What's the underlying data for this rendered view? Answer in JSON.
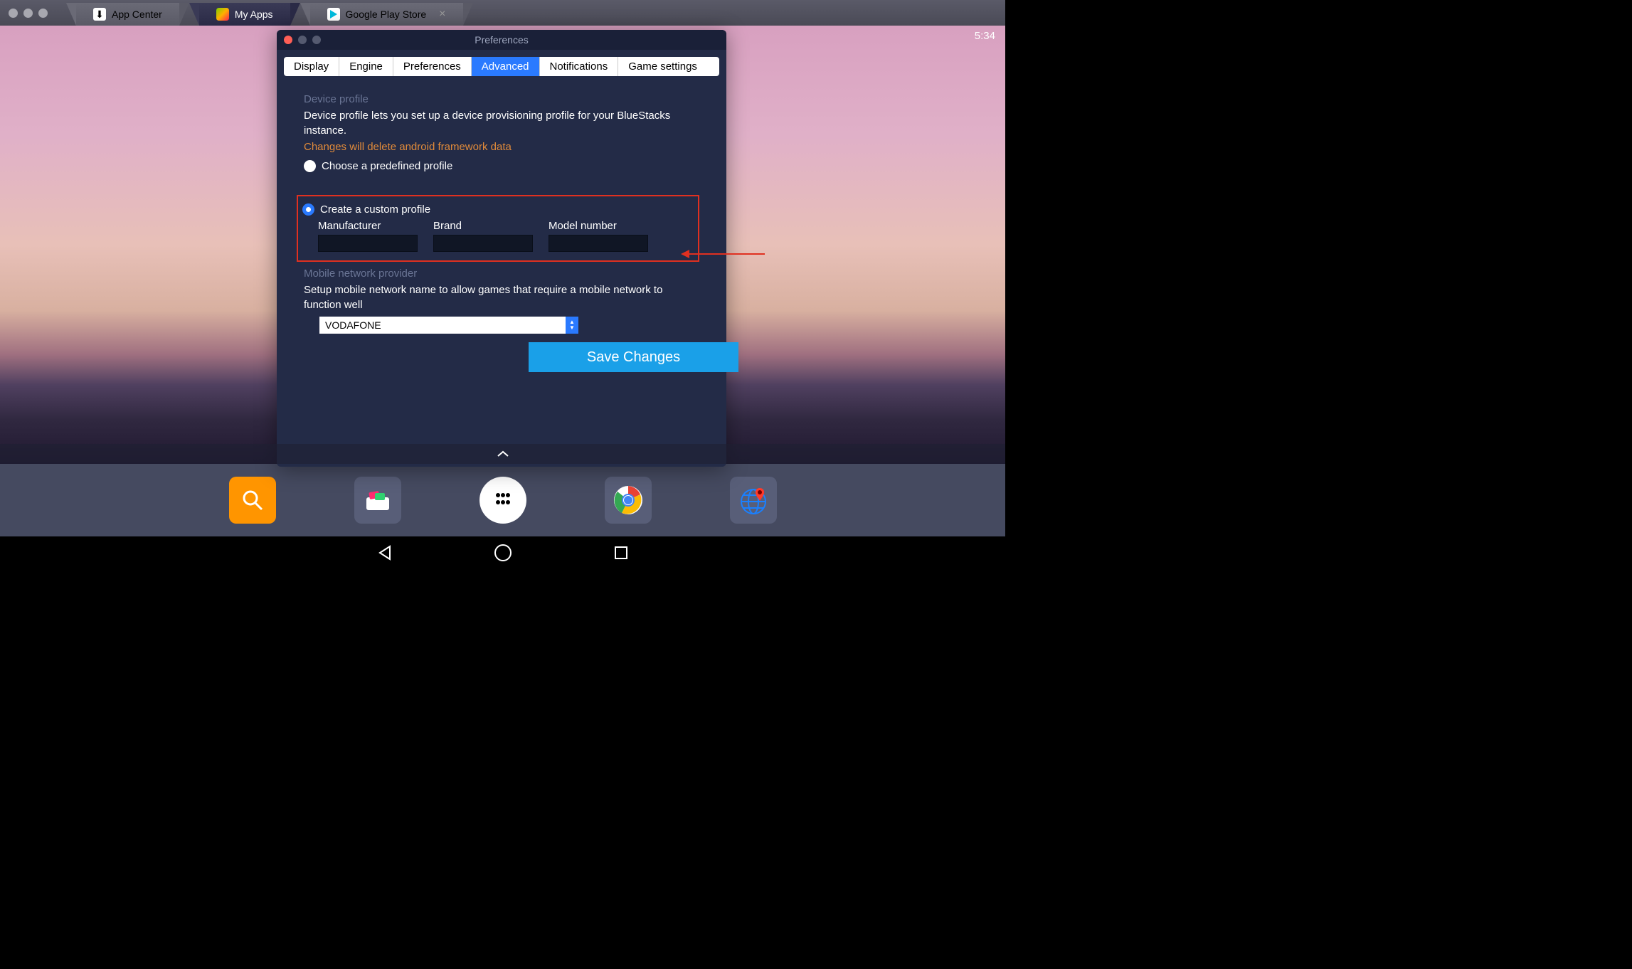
{
  "chrome_tabs": [
    {
      "label": "App Center"
    },
    {
      "label": "My Apps"
    },
    {
      "label": "Google Play Store"
    }
  ],
  "clock": "5:34",
  "pref": {
    "title": "Preferences",
    "tabs": [
      "Display",
      "Engine",
      "Preferences",
      "Advanced",
      "Notifications",
      "Game settings"
    ],
    "active_tab": 3,
    "device_profile": {
      "heading": "Device profile",
      "desc": "Device profile lets you set up a device provisioning profile for your BlueStacks instance.",
      "warning": "Changes will delete android framework data",
      "predefined_label": "Choose a predefined profile",
      "custom_label": "Create a custom profile",
      "fields": {
        "manufacturer_label": "Manufacturer",
        "brand_label": "Brand",
        "model_label": "Model number",
        "manufacturer_value": "",
        "brand_value": "",
        "model_value": ""
      }
    },
    "mobile_network": {
      "heading": "Mobile network provider",
      "desc": "Setup mobile network name to allow games that require a mobile network to function well",
      "selected": "VODAFONE"
    },
    "save_label": "Save Changes"
  }
}
